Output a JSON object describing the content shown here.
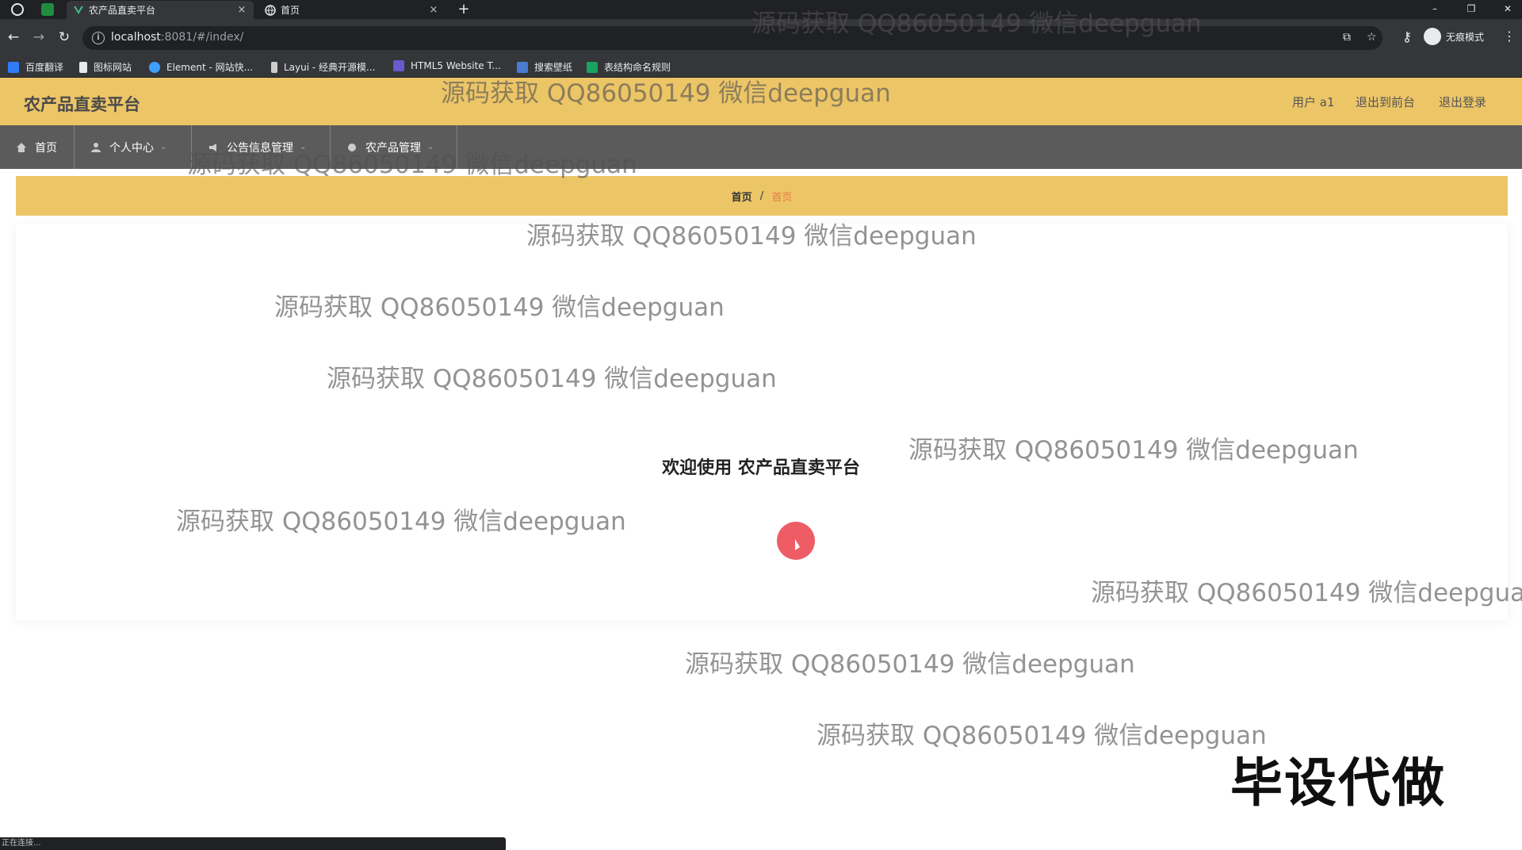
{
  "browser": {
    "tabs": [
      {
        "title": "农产品直卖平台",
        "close": "×"
      },
      {
        "title": "首页",
        "close": "×"
      }
    ],
    "new_tab": "+",
    "window_controls": {
      "minimize": "–",
      "restore": "❐",
      "close": "✕"
    },
    "url": {
      "host": "localhost",
      "rest": ":8081/#/index/"
    },
    "incognito_label": "无痕模式",
    "bookmarks": [
      {
        "label": "百度翻译",
        "color": "#2f7cf6"
      },
      {
        "label": "图标网站",
        "color": "#ffffff"
      },
      {
        "label": "Element - 网站快...",
        "color": "#409eff"
      },
      {
        "label": "Layui - 经典开源模...",
        "color": "#cccccc"
      },
      {
        "label": "HTML5 Website T...",
        "color": "#6a5acd"
      },
      {
        "label": "搜索壁纸",
        "color": "#4a7bd0"
      },
      {
        "label": "表结构命名规则",
        "color": "#1aa260"
      }
    ],
    "status_text": "正在连接..."
  },
  "app": {
    "title": "农产品直卖平台",
    "header_links": {
      "user": "用户 a1",
      "to_front": "退出到前台",
      "logout": "退出登录"
    },
    "nav": [
      {
        "label": "首页",
        "icon": "home-icon"
      },
      {
        "label": "个人中心",
        "icon": "user-icon"
      },
      {
        "label": "公告信息管理",
        "icon": "notice-icon"
      },
      {
        "label": "农产品管理",
        "icon": "product-icon"
      }
    ],
    "breadcrumb": {
      "root": "首页",
      "separator": "/",
      "current": "首页"
    },
    "welcome": "欢迎使用 农产品直卖平台"
  },
  "overlay": {
    "watermark": "源码获取 QQ86050149 微信deepguan",
    "corner_text": "毕设代做"
  },
  "colors": {
    "header_bg": "#ecc567",
    "nav_bg": "#5b5b5b",
    "breadcrumb_current": "#e7794a"
  }
}
